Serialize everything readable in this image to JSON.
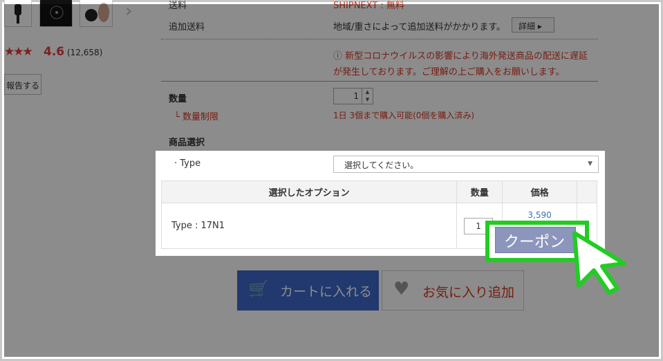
{
  "top": {
    "shipping_label": "送料",
    "shipping_value": "SHIPNEXT : 無料",
    "extra_shipping_label": "追加送料",
    "extra_shipping_value": "地域/重さによって追加送料がかかります。",
    "detail_button": "詳細 ▸",
    "notice_line1": "ⓘ 新型コロナウイルスの影響により海外発送商品の配送に遅延",
    "notice_line2": "が発生しております。ご理解の上ご購入をお願いします。",
    "qty_label": "数量",
    "qty_value": "1",
    "qty_limit_label": "└ 数量制限",
    "qty_limit_value": "1日 3個まで購入可能(0個を購入済み)",
    "product_select_label": "商品選択"
  },
  "left": {
    "stars": "★★★",
    "rating": "4.6",
    "rating_count": "(12,658)",
    "report_button": "報告する"
  },
  "panel": {
    "type_label": "· Type",
    "type_select_value": "選択してください。",
    "table": {
      "headers": [
        "選択したオプション",
        "数量",
        "価格"
      ],
      "row": {
        "option": "Type : 17N1",
        "qty": "1",
        "price": "3,590"
      }
    }
  },
  "buttons": {
    "cart_label": "カートに入れる",
    "favorite_label": "お気に入り追加",
    "coupon_label": "クーポン"
  },
  "colors": {
    "accent_red": "#d8351f",
    "cart_blue": "#3c69c9",
    "highlight_green": "#22cc22",
    "coupon_purple": "#8c96bd",
    "price_blue": "#3a6fb8"
  }
}
